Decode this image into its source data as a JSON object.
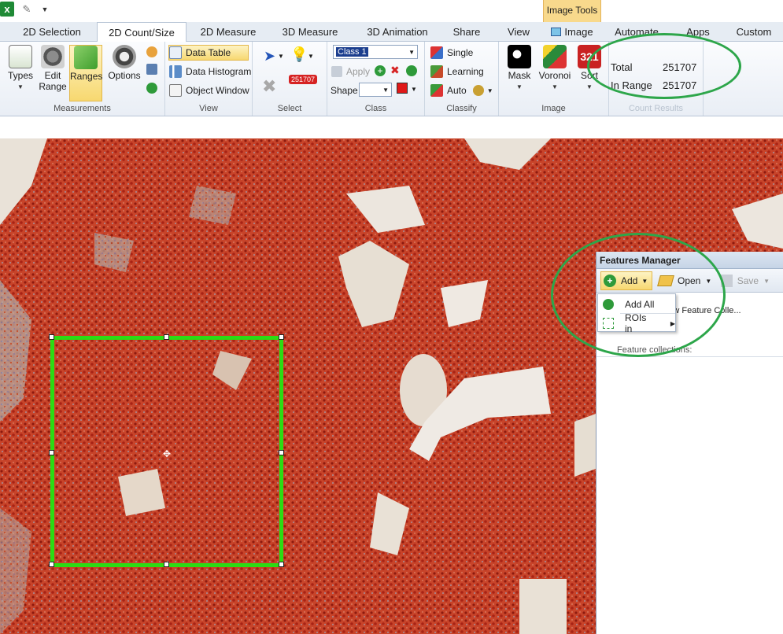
{
  "qat": {
    "app_icon": "excel-icon",
    "undo_icon": "pin-icon",
    "customize_icon": "qat-dropdown-icon"
  },
  "context_tab": {
    "label": "Image Tools"
  },
  "tabs": [
    "2D Selection",
    "2D Count/Size",
    "2D Measure",
    "3D Measure",
    "3D Animation",
    "Share",
    "View",
    "Image",
    "Automate",
    "Apps",
    "Custom"
  ],
  "active_tab": "2D Count/Size",
  "ribbon": {
    "measurements": {
      "label": "Measurements",
      "types": "Types",
      "edit_range": "Edit\nRange",
      "ranges": "Ranges",
      "options": "Options"
    },
    "view": {
      "label": "View",
      "data_table": "Data Table",
      "data_histogram": "Data Histogram",
      "object_window": "Object Window"
    },
    "select": {
      "label": "Select",
      "badge": "251707"
    },
    "class": {
      "label": "Class",
      "class_value": "Class 1",
      "apply": "Apply",
      "shape": "Shape"
    },
    "classify": {
      "label": "Classify",
      "single": "Single",
      "learning": "Learning",
      "auto": "Auto"
    },
    "image": {
      "label": "Image",
      "mask": "Mask",
      "voronoi": "Voronoi",
      "sort": "Sort",
      "sort_glyph": "321"
    },
    "count_results": {
      "label": "Count Results",
      "total_label": "Total",
      "total_value": "251707",
      "in_range_label": "In Range",
      "in_range_value": "251707"
    }
  },
  "features_manager": {
    "title": "Features Manager",
    "add": "Add",
    "open": "Open",
    "save": "Save",
    "description": "...o create a new Feature Colle...\n...d tool.",
    "collections_label": "Feature collections:",
    "menu": {
      "add_all": "Add All",
      "rois_in": "ROIs in"
    }
  },
  "colors": {
    "roi": "#2bdc13",
    "annotation_oval": "#2da64a",
    "context_tab": "#f8d98c"
  }
}
